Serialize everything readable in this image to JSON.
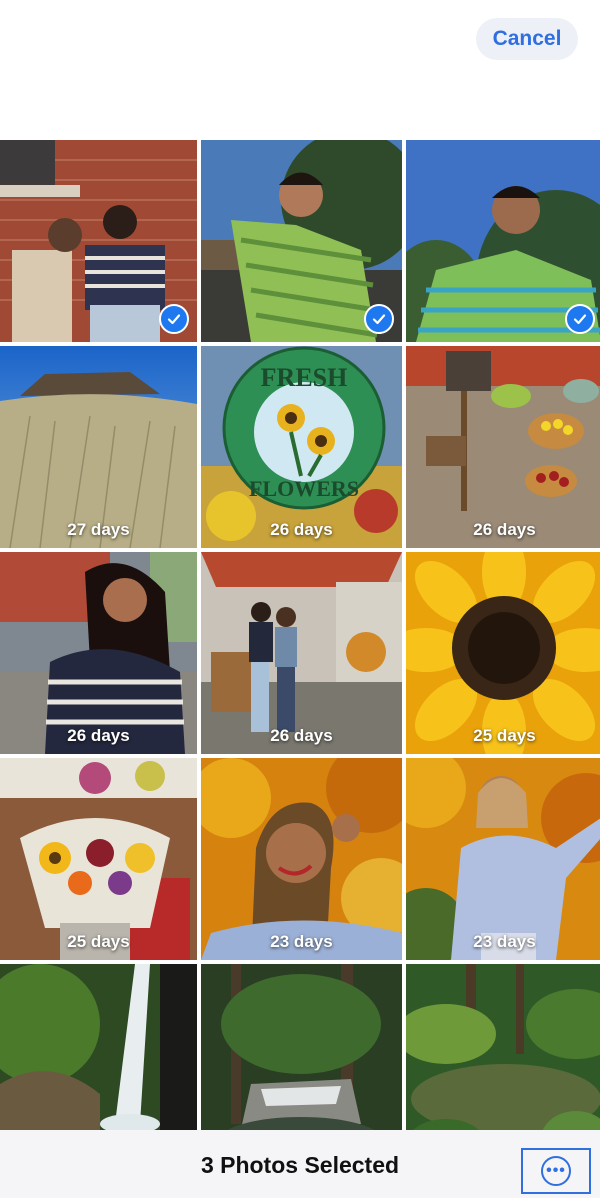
{
  "header": {
    "cancel_label": "Cancel"
  },
  "grid": {
    "photos": [
      {
        "description_icon": "couple-brick-wall-photo",
        "days": "",
        "selected": true
      },
      {
        "description_icon": "man-striped-sweater-photo",
        "days": "",
        "selected": true
      },
      {
        "description_icon": "man-sweater-selfie-photo",
        "days": "",
        "selected": true
      },
      {
        "description_icon": "mesa-grassland-photo",
        "days": "27 days",
        "selected": false
      },
      {
        "description_icon": "fresh-flowers-sign-photo",
        "days": "26 days",
        "selected": false
      },
      {
        "description_icon": "produce-market-photo",
        "days": "26 days",
        "selected": false
      },
      {
        "description_icon": "woman-striped-sweater-photo",
        "days": "26 days",
        "selected": false
      },
      {
        "description_icon": "couple-market-stall-photo",
        "days": "26 days",
        "selected": false
      },
      {
        "description_icon": "sunflower-closeup-photo",
        "days": "25 days",
        "selected": false
      },
      {
        "description_icon": "flower-bouquet-photo",
        "days": "25 days",
        "selected": false
      },
      {
        "description_icon": "woman-autumn-leaves-photo",
        "days": "23 days",
        "selected": false
      },
      {
        "description_icon": "woman-autumn-pose-photo",
        "days": "23 days",
        "selected": false
      },
      {
        "description_icon": "waterfall-photo",
        "days": "",
        "selected": false
      },
      {
        "description_icon": "forest-stream-photo",
        "days": "",
        "selected": false
      },
      {
        "description_icon": "japanese-garden-pond-photo",
        "days": "",
        "selected": false
      }
    ]
  },
  "toolbar": {
    "title": "3 Photos Selected",
    "more_icon": "ellipsis-circle-icon",
    "more_glyph": "•••"
  },
  "colors": {
    "accent": "#2f6fe0",
    "check_blue": "#1e78f0",
    "toolbar_bg": "#f5f5f7"
  }
}
